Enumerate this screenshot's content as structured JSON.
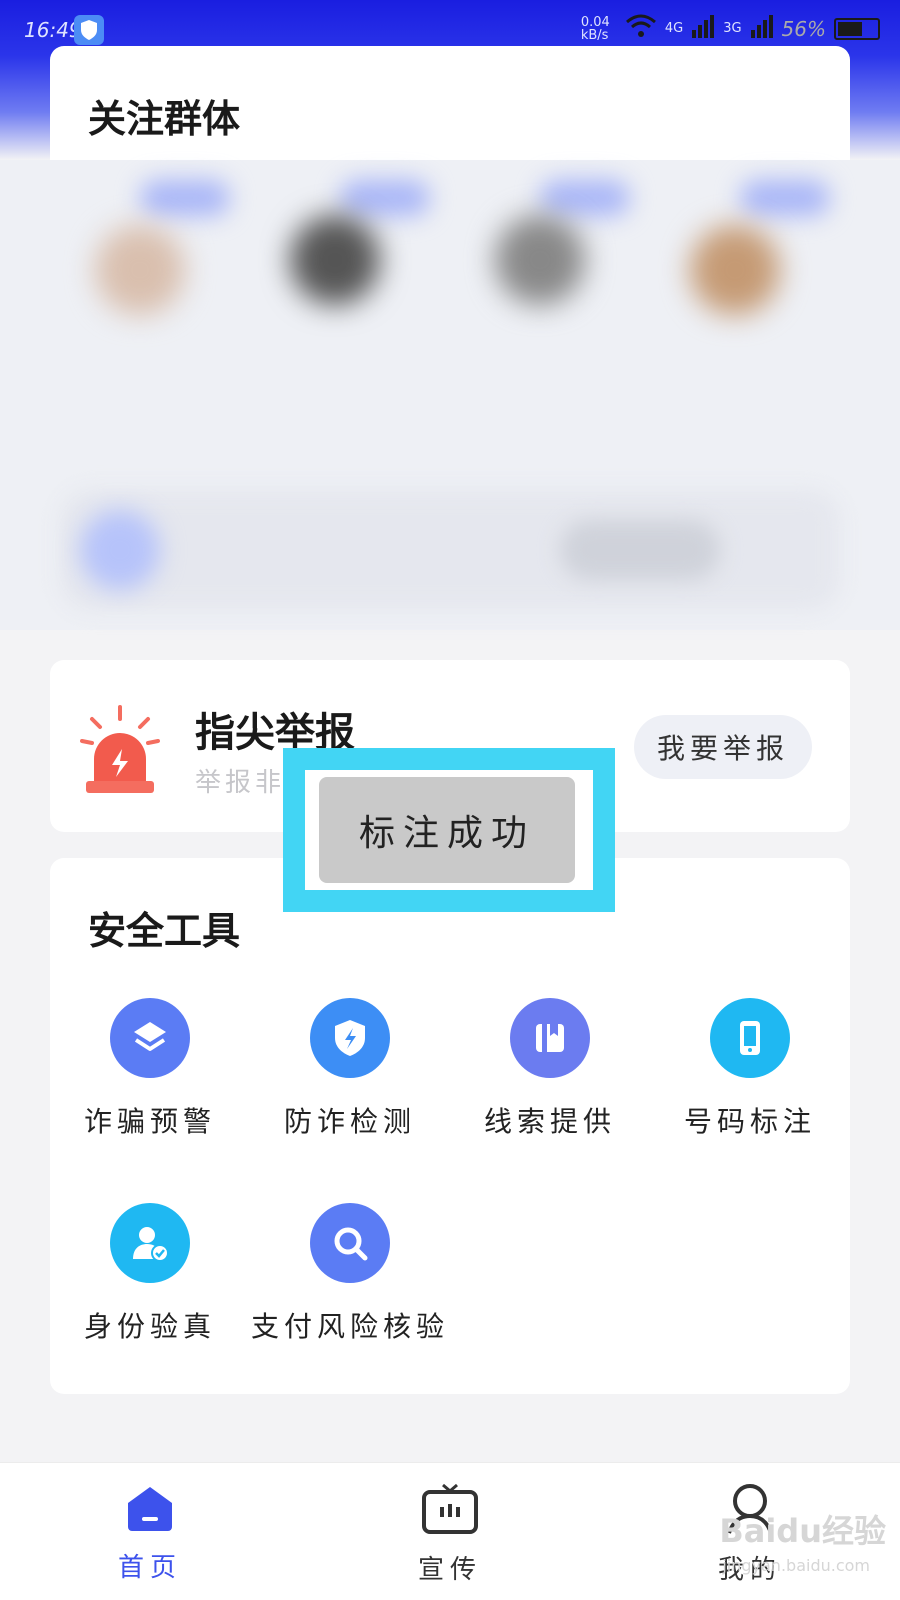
{
  "status_bar": {
    "time": "16:49",
    "net_speed": "0.04 kB/s",
    "sig1": "4G",
    "sig2": "3G",
    "battery": "56%"
  },
  "groups_card": {
    "title": "关注群体"
  },
  "report_card": {
    "title": "指尖举报",
    "subtitle": "举报非",
    "button": "我要举报"
  },
  "toast": {
    "text": "标注成功"
  },
  "tools_card": {
    "title": "安全工具",
    "items": [
      {
        "label": "诈骗预警",
        "icon": "layers-icon"
      },
      {
        "label": "防诈检测",
        "icon": "shield-bolt-icon"
      },
      {
        "label": "线索提供",
        "icon": "book-icon"
      },
      {
        "label": "号码标注",
        "icon": "phone-icon"
      },
      {
        "label": "身份验真",
        "icon": "user-check-icon"
      },
      {
        "label": "支付风险核验",
        "icon": "search-icon"
      }
    ]
  },
  "tabbar": {
    "tabs": [
      {
        "label": "首页",
        "active": true,
        "icon": "home-icon"
      },
      {
        "label": "宣传",
        "active": false,
        "icon": "tv-icon"
      },
      {
        "label": "我的",
        "active": false,
        "icon": "profile-icon"
      }
    ]
  },
  "watermark": {
    "brand": "Baidu经验",
    "url": "jingyan.baidu.com"
  },
  "colors": {
    "primary": "#3d52ec",
    "tool_blue": "#5b7cf4",
    "tool_cyan": "#1fb8f2",
    "highlight": "#42d5f4"
  }
}
